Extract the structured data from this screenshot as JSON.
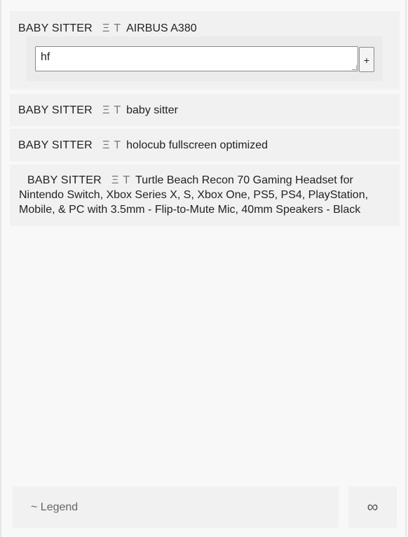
{
  "entries": [
    {
      "tag": "BABY SITTER",
      "symbol_a": "Ξ",
      "symbol_b": "T",
      "text": "AIRBUS A380",
      "input": {
        "value": "hf",
        "add_label": "+"
      }
    },
    {
      "tag": "BABY SITTER",
      "symbol_a": "Ξ",
      "symbol_b": "T",
      "text": "baby sitter"
    },
    {
      "tag": "BABY SITTER",
      "symbol_a": "Ξ",
      "symbol_b": "T",
      "text": "holocub fullscreen optimized"
    },
    {
      "tag": "BABY SITTER",
      "symbol_a": "Ξ",
      "symbol_b": "T",
      "text": "Turtle Beach Recon 70 Gaming Headset for Nintendo Switch, Xbox Series X, S, Xbox One, PS5, PS4, PlayStation, Mobile, & PC with 3.5mm - Flip-to-Mute Mic, 40mm Speakers - Black"
    }
  ],
  "footer": {
    "legend_label": "~ Legend",
    "infinity_label": "∞"
  }
}
